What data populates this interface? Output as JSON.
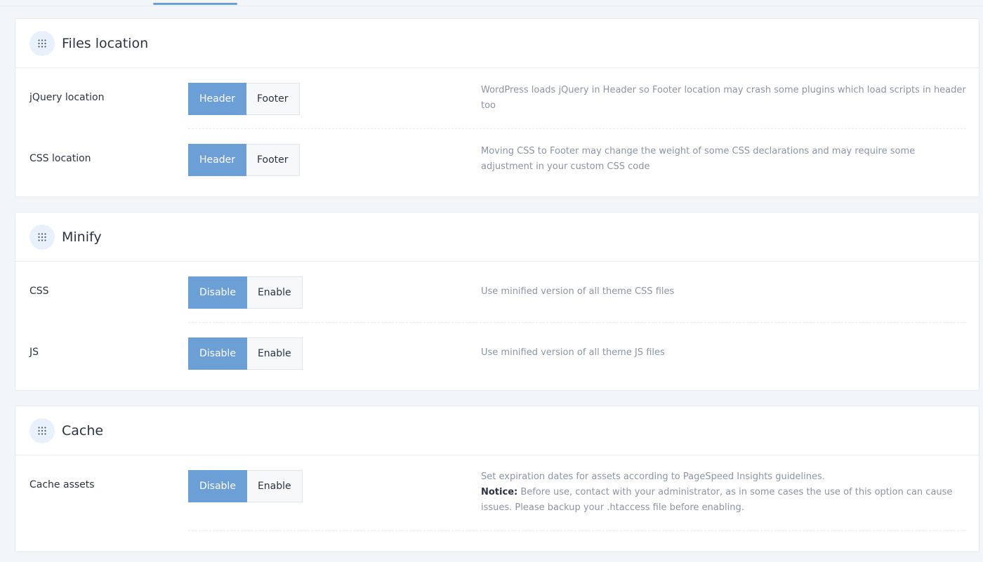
{
  "sections": {
    "files_location": {
      "title": "Files location",
      "rows": [
        {
          "label": "jQuery location",
          "options": [
            "Header",
            "Footer"
          ],
          "selected": "Header",
          "description": "WordPress loads jQuery in Header so Footer location may crash some plugins which load scripts in header too"
        },
        {
          "label": "CSS location",
          "options": [
            "Header",
            "Footer"
          ],
          "selected": "Header",
          "description": "Moving CSS to Footer may change the weight of some CSS declarations and may require some adjustment in your custom CSS code"
        }
      ]
    },
    "minify": {
      "title": "Minify",
      "rows": [
        {
          "label": "CSS",
          "options": [
            "Disable",
            "Enable"
          ],
          "selected": "Disable",
          "description": "Use minified version of all theme CSS files"
        },
        {
          "label": "JS",
          "options": [
            "Disable",
            "Enable"
          ],
          "selected": "Disable",
          "description": "Use minified version of all theme JS files"
        }
      ]
    },
    "cache": {
      "title": "Cache",
      "rows": [
        {
          "label": "Cache assets",
          "options": [
            "Disable",
            "Enable"
          ],
          "selected": "Disable",
          "description": "Set expiration dates for assets according to PageSpeed Insights guidelines.",
          "notice_label": "Notice:",
          "notice_text": " Before use, contact with your administrator, as in some cases the use of this option can cause issues. Please backup your .htaccess file before enabling."
        }
      ]
    }
  },
  "colors": {
    "accent": "#6d9fd7",
    "page_bg": "#f3f6f9",
    "text": "#2b3442",
    "muted": "#8a94a3"
  },
  "icons": {
    "section_handle": "grip-dots-icon"
  }
}
